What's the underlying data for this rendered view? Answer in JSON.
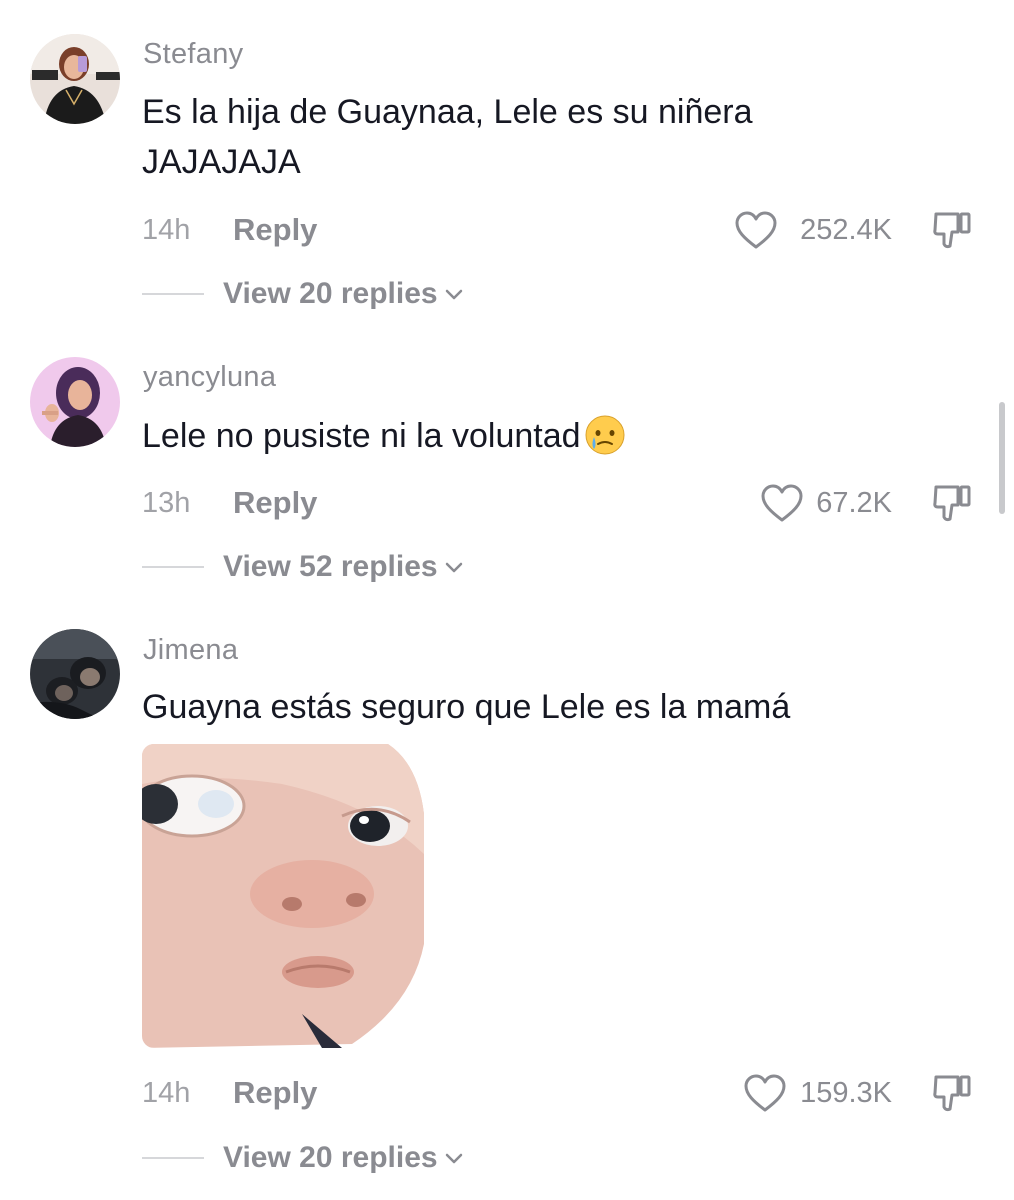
{
  "comments": [
    {
      "username": "Stefany",
      "text": "Es la hija de Guaynaa, Lele es su niñera JAJAJAJA",
      "time": "14h",
      "reply_label": "Reply",
      "likes": "252.4K",
      "view_replies": "View 20 replies"
    },
    {
      "username": "yancyluna",
      "text": "Lele no pusiste ni la voluntad",
      "emoji": "crying-face-emoji",
      "time": "13h",
      "reply_label": "Reply",
      "likes": "67.2K",
      "view_replies": "View 52 replies"
    },
    {
      "username": "Jimena",
      "text": "Guayna estás seguro que Lele es la mamá",
      "sticker": "baby-face-sticker",
      "time": "14h",
      "reply_label": "Reply",
      "likes": "159.3K",
      "view_replies": "View 20 replies"
    }
  ],
  "icons": {
    "like": "heart-outline-icon",
    "dislike": "thumbs-down-icon",
    "expand": "chevron-down-icon"
  },
  "colors": {
    "text_primary": "#161823",
    "text_secondary": "#8a8b91",
    "text_muted": "#a1a2a7"
  }
}
